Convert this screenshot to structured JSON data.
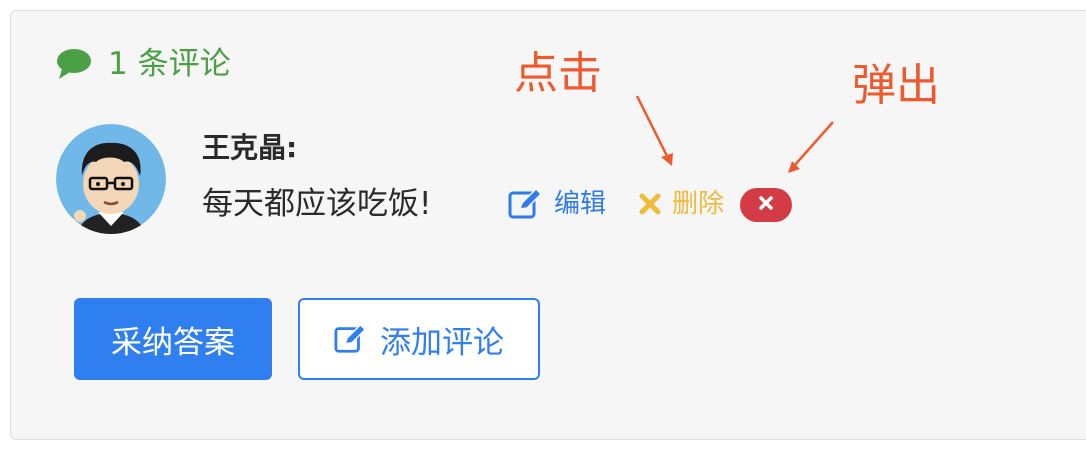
{
  "comments": {
    "header_icon": "comment-bubble-icon",
    "count_label": "1 条评论"
  },
  "comment": {
    "avatar": "user-avatar",
    "author": "王克晶:",
    "text": "每天都应该吃饭!",
    "edit_icon": "edit-icon",
    "edit_label": "编辑",
    "delete_icon": "x-icon",
    "delete_label": "删除",
    "confirm_icon": "close-circle-icon"
  },
  "annotations": {
    "click_label": "点击",
    "popup_label": "弹出"
  },
  "actions": {
    "accept_label": "采纳答案",
    "add_comment_icon": "edit-icon",
    "add_comment_label": "添加评论"
  },
  "colors": {
    "green": "#4b9f47",
    "blue": "#2f7ff0",
    "yellow": "#f0ba3a",
    "red": "#d33b45",
    "annotation": "#ee5a2d",
    "panel_bg": "#f6f6f6"
  }
}
